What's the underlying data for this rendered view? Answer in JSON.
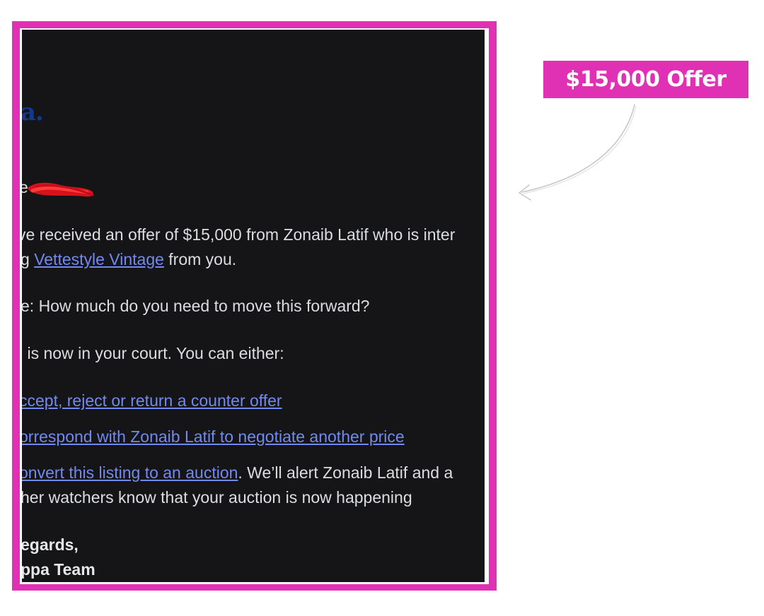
{
  "annotation": {
    "badge_text": "$15,000 Offer",
    "badge_color": "#e030b4",
    "frame_color": "#e030b4"
  },
  "email": {
    "logo_fragment": "a.",
    "greeting_fragment": "e",
    "offer_line_1": "ve received an offer of $15,000 from Zonaib Latif who is inter",
    "offer_line_2_prefix": "g ",
    "listing_link": "Vettestyle Vintage",
    "offer_line_2_suffix": " from you.",
    "message_line": "e: How much do you need to move this forward?",
    "court_line": "l is now in your court. You can either:",
    "option_1_link": "ccept, reject or return a counter offer",
    "option_2_link": "orrespond with Zonaib Latif to negotiate another price",
    "option_3_link": "onvert this listing to an auction",
    "option_3_suffix": ". We’ll alert Zonaib Latif and a",
    "option_3_line_2": "her watchers know that your auction is now happening",
    "signoff_1": "egards,",
    "signoff_2": "ppa Team",
    "link_color": "#7289f0",
    "background_color": "#151517"
  }
}
